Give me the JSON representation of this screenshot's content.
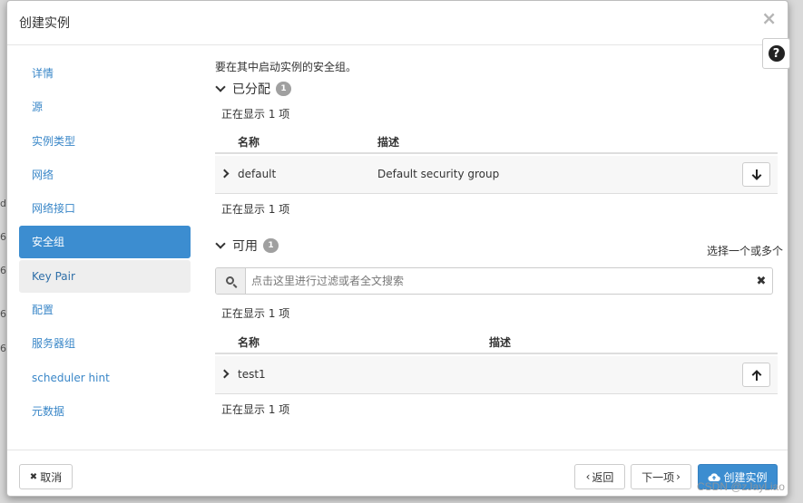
{
  "backdrop": {
    "fragments": [
      "d",
      "6",
      "6",
      "6",
      "6"
    ]
  },
  "modal": {
    "title": "创建实例",
    "close_glyph": "×",
    "help_glyph": "?"
  },
  "sidebar": {
    "items": [
      {
        "label": "详情"
      },
      {
        "label": "源"
      },
      {
        "label": "实例类型"
      },
      {
        "label": "网络"
      },
      {
        "label": "网络接口"
      },
      {
        "label": "安全组",
        "active": true
      },
      {
        "label": "Key Pair",
        "hover": true
      },
      {
        "label": "配置"
      },
      {
        "label": "服务器组"
      },
      {
        "label": "scheduler hint"
      },
      {
        "label": "元数据"
      }
    ]
  },
  "content": {
    "intro": "要在其中启动实例的安全组。",
    "allocated": {
      "title": "已分配",
      "count": "1",
      "showing_top": "正在显示 1 项",
      "showing_bottom": "正在显示 1 项",
      "columns": [
        "名称",
        "描述"
      ],
      "rows": [
        {
          "name": "default",
          "description": "Default security group",
          "action_icon": "arrow-down-icon"
        }
      ]
    },
    "available": {
      "title": "可用",
      "count": "1",
      "hint": "选择一个或多个",
      "search_placeholder": "点击这里进行过滤或者全文搜索",
      "search_value": "",
      "showing_top": "正在显示 1 项",
      "showing_bottom": "正在显示 1 项",
      "columns": [
        "名称",
        "描述"
      ],
      "rows": [
        {
          "name": "test1",
          "description": "",
          "action_icon": "arrow-up-icon"
        }
      ]
    }
  },
  "footer": {
    "cancel": "取消",
    "back": "返回",
    "next": "下一项",
    "create": "创建实例"
  },
  "watermark": "CSDN @zJayLiao",
  "colors": {
    "primary": "#3c8dd0",
    "link": "#3a87c8"
  }
}
